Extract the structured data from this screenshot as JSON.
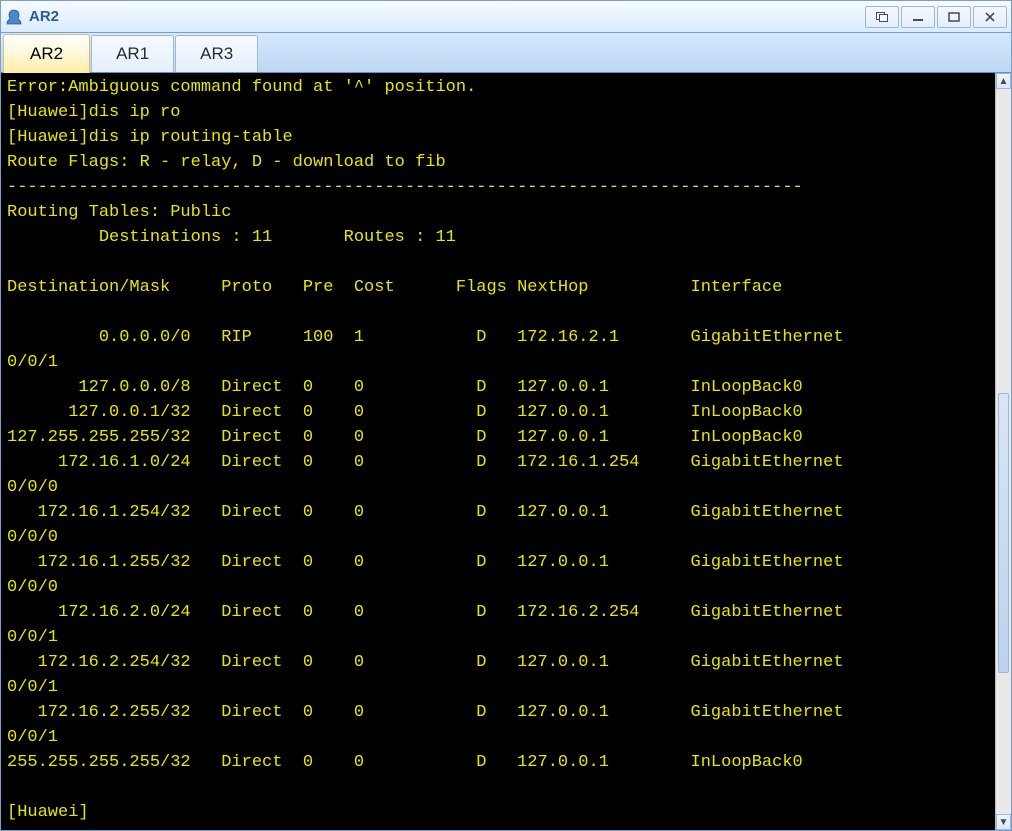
{
  "window": {
    "title": "AR2"
  },
  "tabs": [
    {
      "label": "AR2",
      "active": true
    },
    {
      "label": "AR1",
      "active": false
    },
    {
      "label": "AR3",
      "active": false
    }
  ],
  "terminal": {
    "error_line": "Error:Ambiguous command found at '^' position.",
    "cmd1": "[Huawei]dis ip ro",
    "cmd2": "[Huawei]dis ip routing-table",
    "flags_line": "Route Flags: R - relay, D - download to fib",
    "divider": "------------------------------------------------------------------------------",
    "tables_line": "Routing Tables: Public",
    "counts_line": "         Destinations : 11       Routes : 11",
    "header": {
      "dest": "Destination/Mask",
      "proto": "Proto",
      "pre": "Pre",
      "cost": "Cost",
      "flags": "Flags",
      "nexthop": "NextHop",
      "iface": "Interface"
    },
    "routes": [
      {
        "dest": "0.0.0.0/0",
        "proto": "RIP",
        "pre": "100",
        "cost": "1",
        "flags": "D",
        "nexthop": "172.16.2.1",
        "iface": "GigabitEthernet",
        "ifsuf": "0/0/1"
      },
      {
        "dest": "127.0.0.0/8",
        "proto": "Direct",
        "pre": "0",
        "cost": "0",
        "flags": "D",
        "nexthop": "127.0.0.1",
        "iface": "InLoopBack0",
        "ifsuf": ""
      },
      {
        "dest": "127.0.0.1/32",
        "proto": "Direct",
        "pre": "0",
        "cost": "0",
        "flags": "D",
        "nexthop": "127.0.0.1",
        "iface": "InLoopBack0",
        "ifsuf": ""
      },
      {
        "dest": "127.255.255.255/32",
        "proto": "Direct",
        "pre": "0",
        "cost": "0",
        "flags": "D",
        "nexthop": "127.0.0.1",
        "iface": "InLoopBack0",
        "ifsuf": ""
      },
      {
        "dest": "172.16.1.0/24",
        "proto": "Direct",
        "pre": "0",
        "cost": "0",
        "flags": "D",
        "nexthop": "172.16.1.254",
        "iface": "GigabitEthernet",
        "ifsuf": "0/0/0"
      },
      {
        "dest": "172.16.1.254/32",
        "proto": "Direct",
        "pre": "0",
        "cost": "0",
        "flags": "D",
        "nexthop": "127.0.0.1",
        "iface": "GigabitEthernet",
        "ifsuf": "0/0/0"
      },
      {
        "dest": "172.16.1.255/32",
        "proto": "Direct",
        "pre": "0",
        "cost": "0",
        "flags": "D",
        "nexthop": "127.0.0.1",
        "iface": "GigabitEthernet",
        "ifsuf": "0/0/0"
      },
      {
        "dest": "172.16.2.0/24",
        "proto": "Direct",
        "pre": "0",
        "cost": "0",
        "flags": "D",
        "nexthop": "172.16.2.254",
        "iface": "GigabitEthernet",
        "ifsuf": "0/0/1"
      },
      {
        "dest": "172.16.2.254/32",
        "proto": "Direct",
        "pre": "0",
        "cost": "0",
        "flags": "D",
        "nexthop": "127.0.0.1",
        "iface": "GigabitEthernet",
        "ifsuf": "0/0/1"
      },
      {
        "dest": "172.16.2.255/32",
        "proto": "Direct",
        "pre": "0",
        "cost": "0",
        "flags": "D",
        "nexthop": "127.0.0.1",
        "iface": "GigabitEthernet",
        "ifsuf": "0/0/1"
      },
      {
        "dest": "255.255.255.255/32",
        "proto": "Direct",
        "pre": "0",
        "cost": "0",
        "flags": "D",
        "nexthop": "127.0.0.1",
        "iface": "InLoopBack0",
        "ifsuf": ""
      }
    ],
    "prompt": "[Huawei]"
  },
  "columns": {
    "dest": 18,
    "proto": 7,
    "pre": 4,
    "cost": 10,
    "flags": 4,
    "nexthop": 15
  }
}
